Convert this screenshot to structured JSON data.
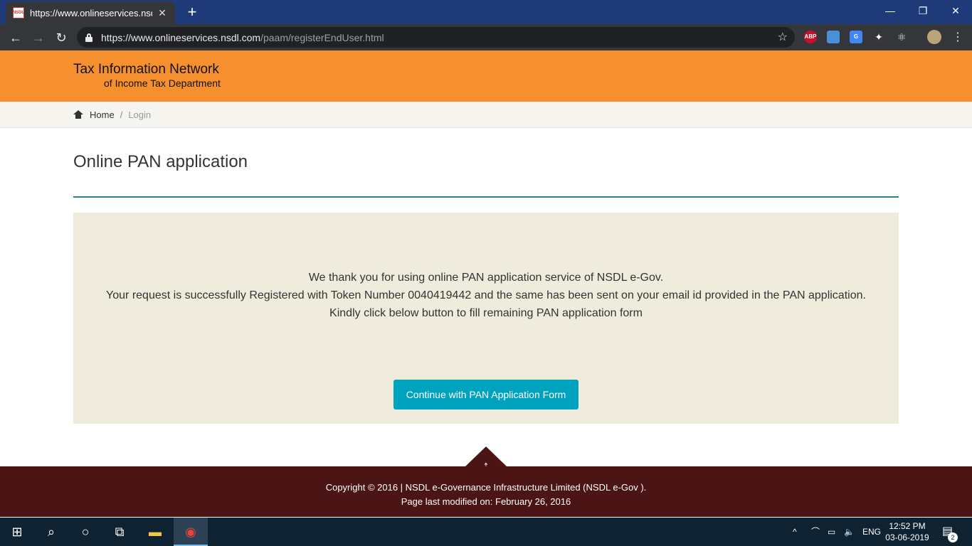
{
  "browser": {
    "tab_title": "https://www.onlineservices.nsdl.c",
    "favicon_text": "NSDL",
    "url_host": "https://www.onlineservices.nsdl.com",
    "url_path": "/paam/registerEndUser.html",
    "extensions": [
      {
        "name": "adblock-plus-icon",
        "label": "ABP",
        "color": "#c8102e"
      },
      {
        "name": "extension-window-icon",
        "label": "",
        "color": "#4a90d9"
      },
      {
        "name": "google-translate-icon",
        "label": "G",
        "color": "#4285f4"
      },
      {
        "name": "cat-extension-icon",
        "label": "",
        "color": "#111111"
      },
      {
        "name": "react-devtools-icon",
        "label": "",
        "color": "#61dafb"
      }
    ]
  },
  "site": {
    "brand_line1": "Tax Information Network",
    "brand_line2": "of Income Tax Department",
    "header_color": "#f6902f"
  },
  "breadcrumb": {
    "home": "Home",
    "separator": "/",
    "current": "Login"
  },
  "page": {
    "title": "Online PAN application",
    "message_line1": "We thank you for using online PAN application service of NSDL e-Gov.",
    "message_line2": "Your request is successfully Registered with Token Number 0040419442 and the same has been sent on your email id provided in the PAN application.",
    "message_line3": "Kindly click below button to fill remaining PAN application form",
    "continue_button": "Continue with PAN Application Form",
    "accent_color": "#00a3bd"
  },
  "footer": {
    "copyright": "Copyright © 2016 | NSDL e-Governance Infrastructure Limited (NSDL e-Gov ).",
    "last_modified": "Page last modified on: February 26, 2016"
  },
  "taskbar": {
    "language": "ENG",
    "time": "12:52 PM",
    "date": "03-06-2019",
    "notification_count": "2"
  }
}
